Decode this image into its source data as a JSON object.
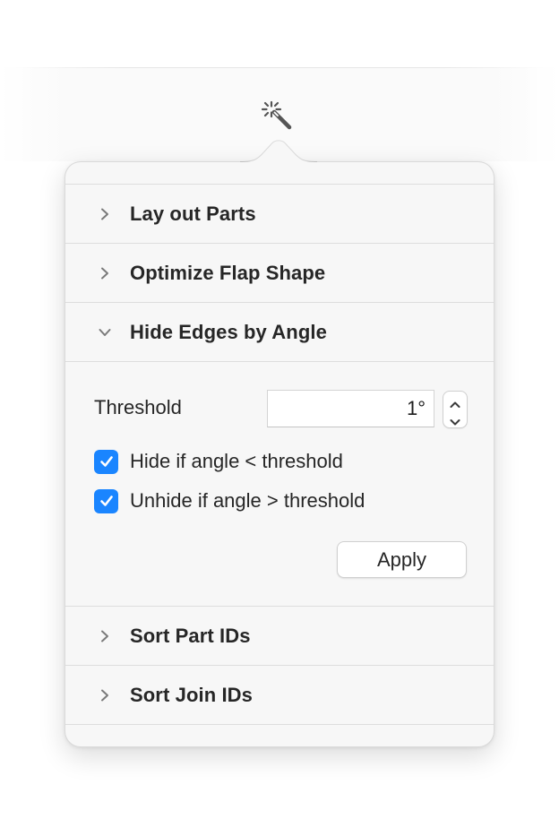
{
  "toolbar": {
    "wand_icon": "magic-wand-icon"
  },
  "popover": {
    "sections": [
      {
        "label": "Lay out Parts",
        "expanded": false
      },
      {
        "label": "Optimize Flap Shape",
        "expanded": false
      },
      {
        "label": "Hide Edges by Angle",
        "expanded": true
      },
      {
        "label": "Sort Part IDs",
        "expanded": false
      },
      {
        "label": "Sort Join IDs",
        "expanded": false
      }
    ],
    "hide_edges": {
      "threshold_label": "Threshold",
      "threshold_value": "1°",
      "checkboxes": [
        {
          "label": "Hide if angle < threshold",
          "checked": true
        },
        {
          "label": "Unhide if angle > threshold",
          "checked": true
        }
      ],
      "apply_label": "Apply"
    }
  },
  "colors": {
    "checkbox_accent": "#1a85ff",
    "popover_background": "#f7f7f7",
    "separator": "#dddddd"
  }
}
